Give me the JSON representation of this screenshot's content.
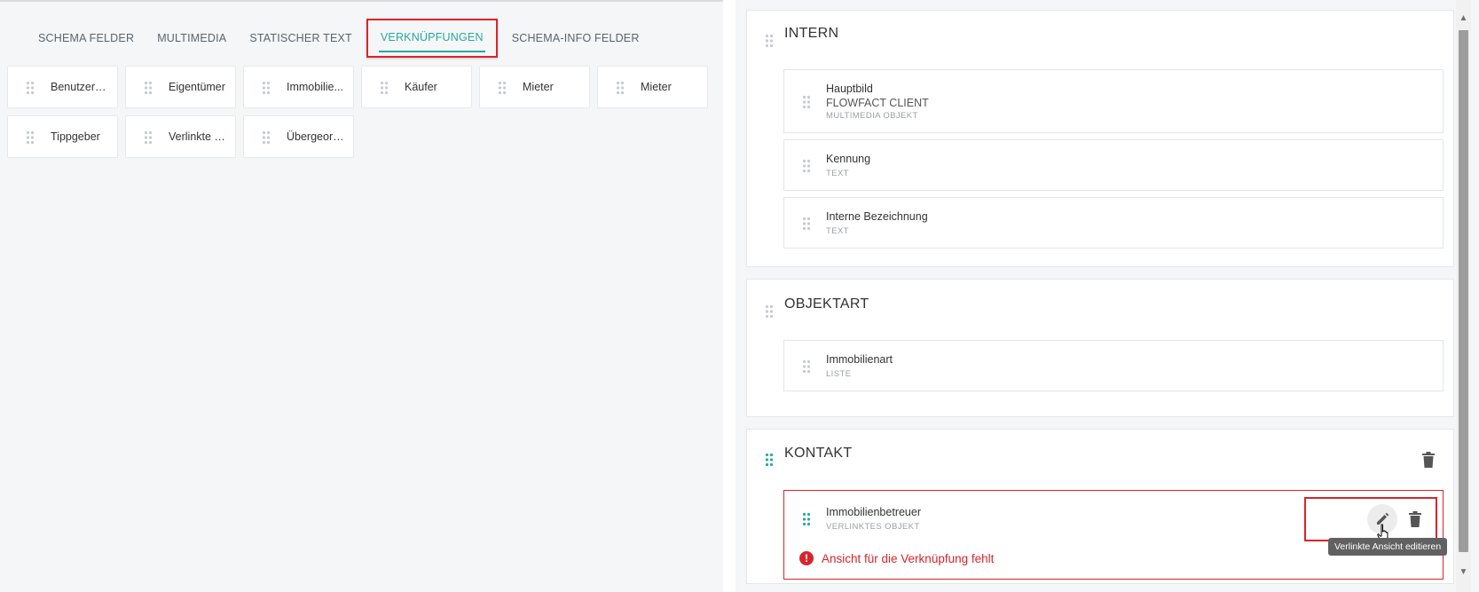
{
  "tabs": [
    {
      "label": "SCHEMA FELDER",
      "active": false
    },
    {
      "label": "MULTIMEDIA",
      "active": false
    },
    {
      "label": "STATISCHER TEXT",
      "active": false
    },
    {
      "label": "VERKNÜPFUNGEN",
      "active": true
    },
    {
      "label": "SCHEMA-INFO FELDER",
      "active": false
    }
  ],
  "chips": {
    "row1": [
      "Benutzerd...",
      "Eigentümer",
      "Immobilie...",
      "Käufer",
      "Mieter",
      "Mieter"
    ],
    "row2": [
      "Tippgeber",
      "Verlinkte E...",
      "Übergeord..."
    ]
  },
  "sections": {
    "intern": {
      "title": "INTERN",
      "fields": [
        {
          "name": "Hauptbild",
          "sub": "FLOWFACT CLIENT",
          "type": "MULTIMEDIA OBJEKT"
        },
        {
          "name": "Kennung",
          "type": "TEXT"
        },
        {
          "name": "Interne Bezeichnung",
          "type": "TEXT"
        }
      ]
    },
    "objektart": {
      "title": "OBJEKTART",
      "fields": [
        {
          "name": "Immobilienart",
          "type": "LISTE"
        }
      ]
    },
    "kontakt": {
      "title": "KONTAKT",
      "fields": [
        {
          "name": "Immobilienbetreuer",
          "type": "VERLINKTES OBJEKT",
          "error": "Ansicht für die Verknüpfung fehlt"
        }
      ]
    }
  },
  "tooltip": "Verlinkte Ansicht editieren",
  "colors": {
    "accent": "#2aa7a1",
    "error": "#d9242b",
    "highlight_border": "#d9242b"
  },
  "icons": [
    "drag-handle-icon",
    "trash-icon",
    "pencil-icon",
    "error-icon",
    "hand-cursor-icon"
  ]
}
